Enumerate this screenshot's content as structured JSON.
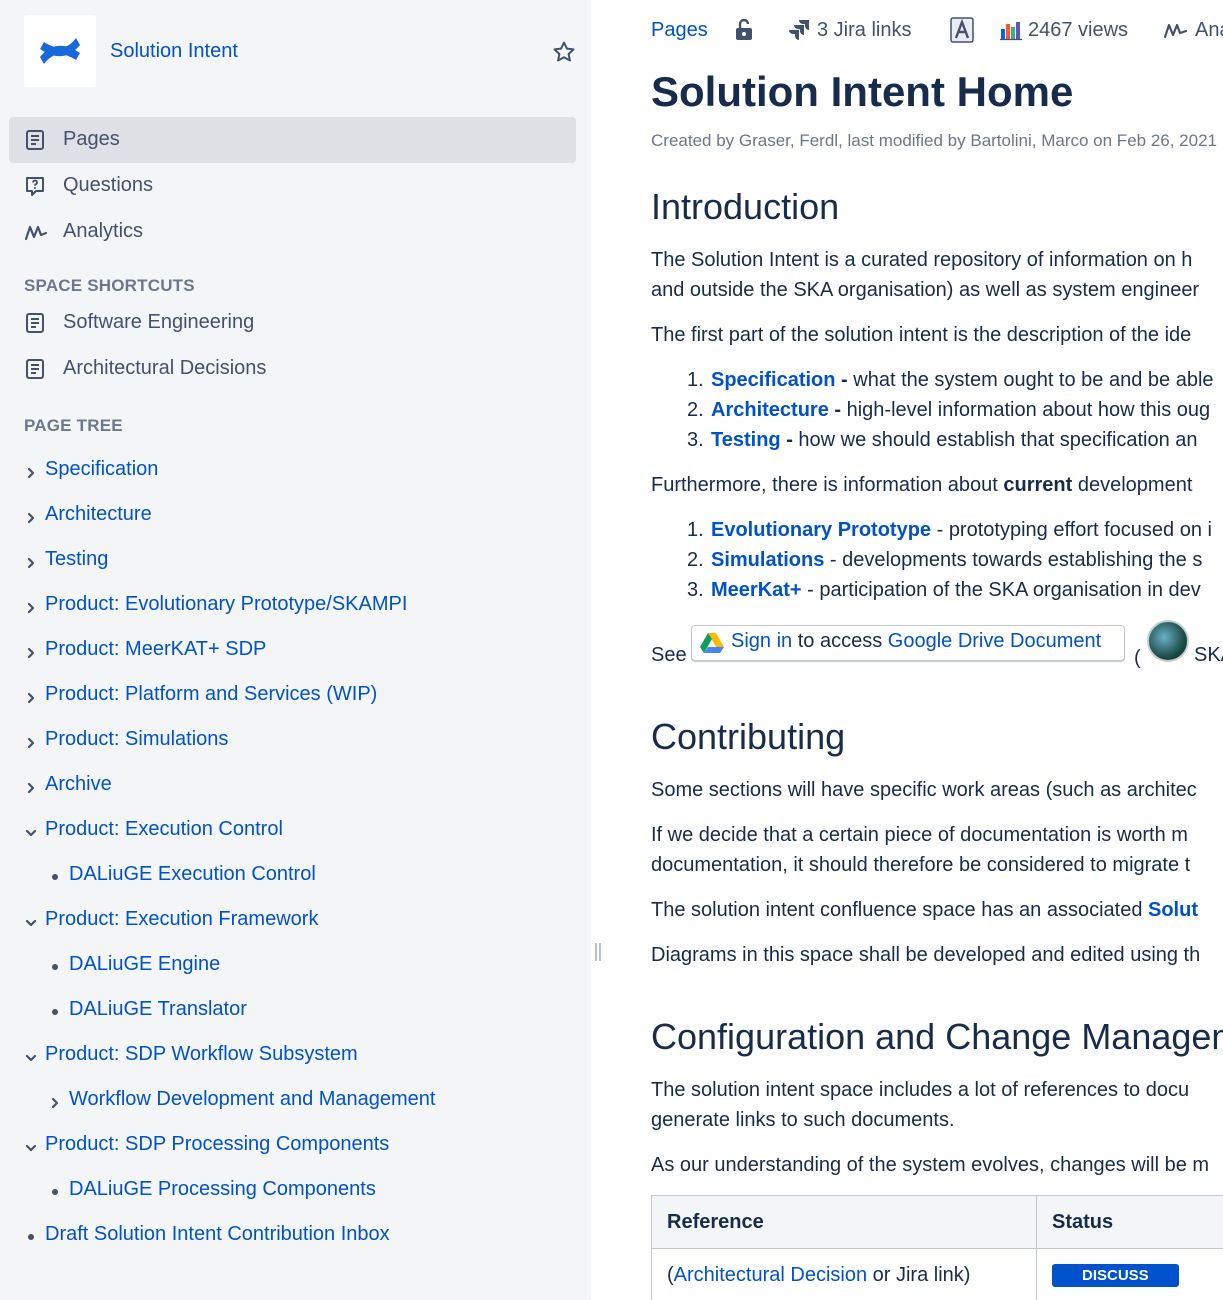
{
  "sidebar": {
    "space_name": "Solution Intent",
    "nav": [
      {
        "label": "Pages"
      },
      {
        "label": "Questions"
      },
      {
        "label": "Analytics"
      }
    ],
    "shortcuts_heading": "SPACE SHORTCUTS",
    "shortcuts": [
      {
        "label": "Software Engineering"
      },
      {
        "label": "Architectural Decisions"
      }
    ],
    "tree_heading": "PAGE TREE",
    "tree": [
      {
        "label": "Specification",
        "icon": "chevron-right"
      },
      {
        "label": "Architecture",
        "icon": "chevron-right"
      },
      {
        "label": "Testing",
        "icon": "chevron-right"
      },
      {
        "label": "Product: Evolutionary Prototype/SKAMPI",
        "icon": "chevron-right"
      },
      {
        "label": "Product: MeerKAT+ SDP",
        "icon": "chevron-right"
      },
      {
        "label": "Product: Platform and Services (WIP)",
        "icon": "chevron-right"
      },
      {
        "label": "Product: Simulations",
        "icon": "chevron-right"
      },
      {
        "label": "Archive",
        "icon": "chevron-right"
      },
      {
        "label": "Product: Execution Control",
        "icon": "chevron-down"
      },
      {
        "label": "DALiuGE Execution Control",
        "icon": "bullet"
      },
      {
        "label": "Product: Execution Framework",
        "icon": "chevron-down"
      },
      {
        "label": "DALiuGE Engine",
        "icon": "bullet"
      },
      {
        "label": "DALiuGE Translator",
        "icon": "bullet"
      },
      {
        "label": "Product: SDP Workflow Subsystem",
        "icon": "chevron-down"
      },
      {
        "label": "Workflow Development and Management",
        "icon": "chevron-right"
      },
      {
        "label": "Product: SDP Processing Components",
        "icon": "chevron-down"
      },
      {
        "label": "DALiuGE Processing Components",
        "icon": "bullet"
      },
      {
        "label": "Draft Solution Intent Contribution Inbox",
        "icon": "bullet"
      }
    ]
  },
  "toolbar": {
    "breadcrumb": "Pages",
    "jira_links": "3 Jira links",
    "views": "2467 views",
    "analytics": "Ana"
  },
  "page": {
    "title": "Solution Intent Home",
    "byline": "Created by Graser, Ferdl, last modified by Bartolini, Marco on Feb 26, 2021",
    "intro_heading": "Introduction",
    "intro_p1_l1": "The Solution Intent is a curated repository of information on h",
    "intro_p1_l2": "and outside the SKA organisation) as well as system engineer",
    "intro_p2": "The first part of the solution intent is the description of the ide",
    "list1": [
      {
        "num": "1.",
        "link": "Specification",
        "sep": " - ",
        "text": "what the system ought to be and be able"
      },
      {
        "num": "2.",
        "link": "Architecture",
        "sep": " - ",
        "text": "high-level information about how this oug"
      },
      {
        "num": "3.",
        "link": "Testing",
        "sep": " - ",
        "text": "how we should establish that specification an"
      }
    ],
    "intro_p3_pre": "Furthermore, there is information about ",
    "intro_p3_bold": "current",
    "intro_p3_post": " development",
    "list2": [
      {
        "num": "1.",
        "link": "Evolutionary Prototype",
        "sep": " - ",
        "text": "prototyping effort focused on i"
      },
      {
        "num": "2.",
        "link": "Simulations",
        "sep": " - ",
        "text": "developments towards establishing the s"
      },
      {
        "num": "3.",
        "link": "MeerKat+",
        "sep": " - ",
        "text": "participation of the SKA organisation in dev"
      }
    ],
    "see_label": "See",
    "gdrive_signin": "Sign in",
    "gdrive_mid": " to access ",
    "gdrive_doc": "Google Drive Document",
    "paren_open": "(",
    "ska_link": "SKA",
    "contrib_heading": "Contributing",
    "contrib_p1": "Some sections will have specific work areas (such as architec",
    "contrib_p2_l1": "If we decide that a certain piece of documentation is worth m",
    "contrib_p2_l2": "documentation, it should therefore be considered to migrate t",
    "contrib_p3_pre": "The solution intent confluence space has an associated ",
    "contrib_p3_link": "Solut",
    "contrib_p4": "Diagrams in this space shall be developed and edited using th",
    "config_heading": "Configuration and Change Managem",
    "config_p1_l1": "The solution intent space includes a lot of references to docu",
    "config_p1_l2": "generate links to such documents.",
    "config_p2": "As our understanding of the system evolves, changes will be m",
    "table": {
      "headers": [
        "Reference",
        "Status"
      ],
      "row_pre": "(",
      "row_link": "Architectural Decision",
      "row_post": " or Jira link)",
      "status": "DISCUSS"
    }
  }
}
